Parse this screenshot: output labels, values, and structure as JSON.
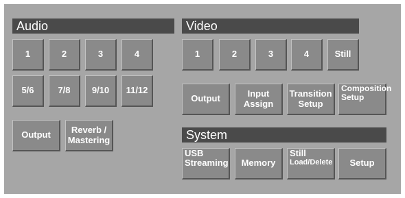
{
  "audio": {
    "title": "Audio",
    "channels": [
      "1",
      "2",
      "3",
      "4",
      "5/6",
      "7/8",
      "9/10",
      "11/12"
    ],
    "output": "Output",
    "reverb": [
      "Reverb /",
      "Mastering"
    ]
  },
  "video": {
    "title": "Video",
    "inputs": [
      "1",
      "2",
      "3",
      "4",
      "Still"
    ],
    "output": "Output",
    "input_assign": [
      "Input",
      "Assign"
    ],
    "transition_setup": [
      "Transition",
      "Setup"
    ],
    "composition_setup": [
      "Composition",
      "Setup"
    ]
  },
  "system": {
    "title": "System",
    "usb_streaming": [
      "USB",
      "Streaming"
    ],
    "memory": "Memory",
    "still_load": [
      "Still",
      "Load/Delete"
    ],
    "setup": "Setup"
  },
  "colors": {
    "panel": "#a6a6a6",
    "header": "#4a4a4a",
    "button": "#8a8a8a",
    "text": "#ffffff"
  }
}
